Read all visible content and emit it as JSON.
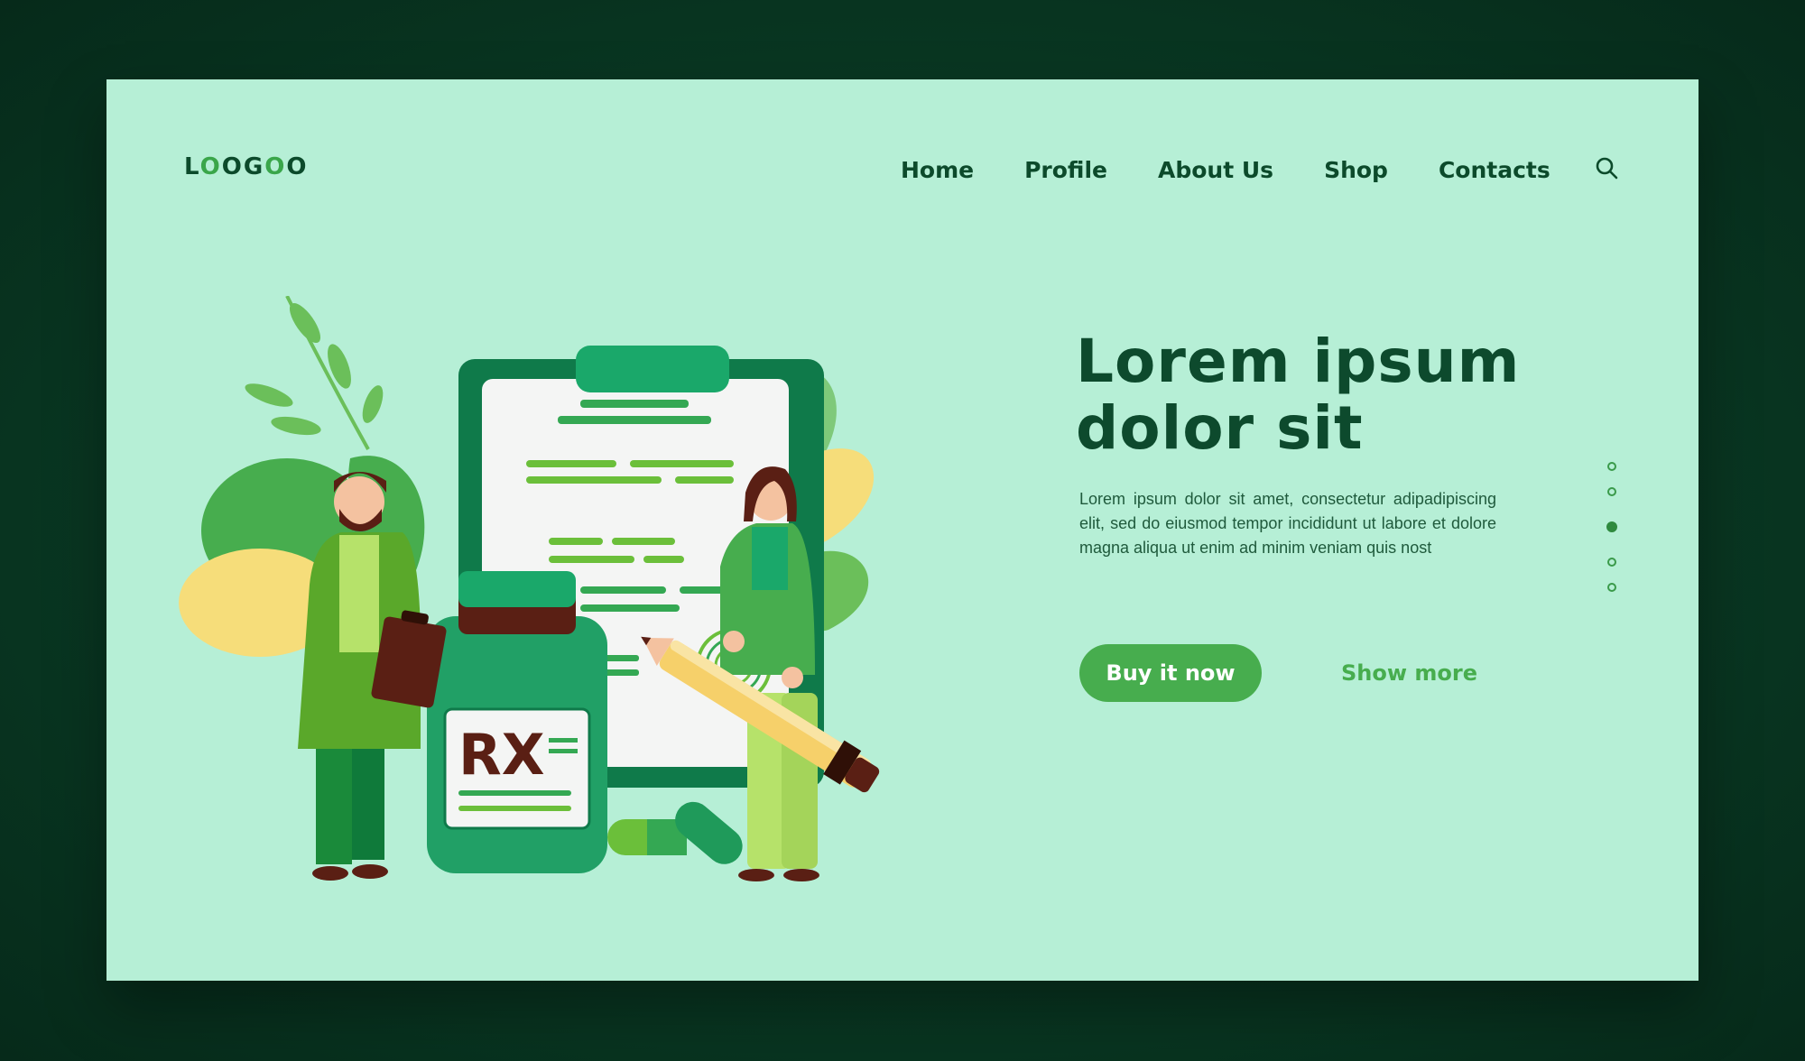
{
  "logo": {
    "text_parts": [
      {
        "t": "L",
        "accent": false
      },
      {
        "t": "O",
        "accent": true
      },
      {
        "t": "O",
        "accent": false
      },
      {
        "t": "G",
        "accent": false
      },
      {
        "t": "O",
        "accent": true
      },
      {
        "t": "O",
        "accent": false
      }
    ]
  },
  "nav": {
    "items": [
      "Home",
      "Profile",
      "About Us",
      "Shop",
      "Contacts"
    ]
  },
  "search": {
    "icon": "search-icon"
  },
  "hero": {
    "title": "Lorem ipsum dolor sit",
    "body": "Lorem ipsum dolor sit amet, consectetur adipadipiscing elit, sed do eiusmod tempor incididunt ut labore et dolore magna aliqua ut enim ad minim veniam quis nost",
    "primary_button": "Buy it now",
    "secondary_button": "Show more"
  },
  "illustration": {
    "bottle_label": "RX"
  },
  "pagination": {
    "count": 5,
    "active_index": 2
  },
  "colors": {
    "background": "#083420",
    "card": "#b6efd6",
    "primary": "#47ad4e",
    "heading": "#0d4a2d"
  }
}
